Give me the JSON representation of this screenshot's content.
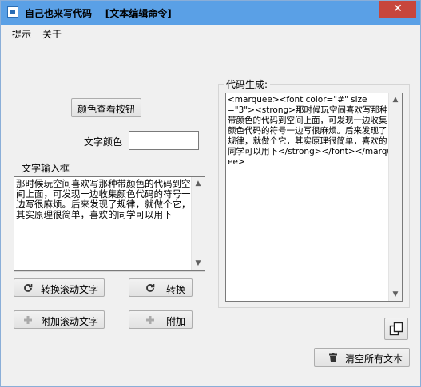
{
  "window": {
    "title": "自己也来写代码    [文本编辑命令]",
    "close_glyph": "✕"
  },
  "menu": [
    {
      "label": "提示"
    },
    {
      "label": "关于"
    }
  ],
  "color_panel": {
    "view_button_label": "颜色查看按钮",
    "text_color_label": "文字颜色",
    "text_color_value": ""
  },
  "input_group": {
    "label": "文字输入框",
    "text": "那时候玩空间喜欢写那种带颜色的代码到空间上面，可发现一边收集颜色代码的符号一边写很麻烦。后来发现了规律，就做个它，其实原理很简单，喜欢的同学可以用下"
  },
  "buttons": {
    "convert_marquee": "转换滚动文字",
    "convert": "转换",
    "append_marquee": "附加滚动文字",
    "append": "附加",
    "clear_all": "清空所有文本"
  },
  "code_group": {
    "label": "代码生成:",
    "code": "<marquee><font color=\"#\" size=\"3\"><strong>那时候玩空间喜欢写那种带颜色的代码到空间上面，可发现一边收集颜色代码的符号一边写很麻烦。后来发现了规律，就做个它，其实原理很简单，喜欢的同学可以用下</strong></font></marquee>"
  },
  "icons": {
    "refresh": "refresh-icon",
    "plus": "plus-icon",
    "copy": "copy-icon",
    "trash": "trash-icon"
  },
  "colors": {
    "title_bar": "#5aa0e6",
    "close_button": "#c7463c",
    "window_bg": "#f0f0f0"
  }
}
